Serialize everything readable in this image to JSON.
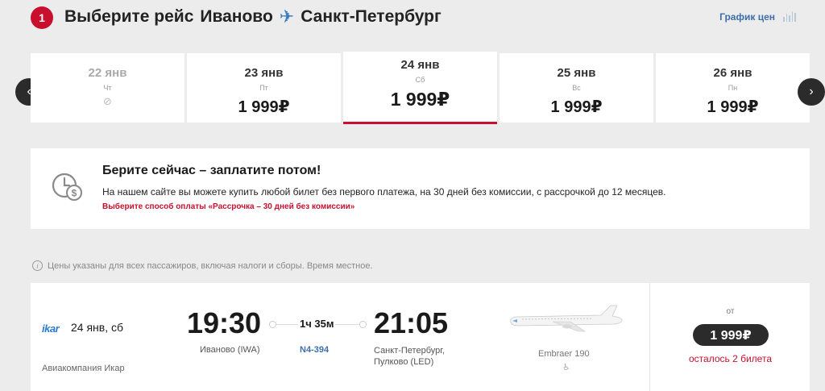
{
  "header": {
    "step": "1",
    "title_prefix": "Выберите рейс",
    "from_city": "Иваново",
    "to_city": "Санкт-Петербург",
    "price_chart_link": "График цен"
  },
  "dates": [
    {
      "date": "22 янв",
      "day": "Чт",
      "price": "",
      "available": false
    },
    {
      "date": "23 янв",
      "day": "Пт",
      "price": "1 999₽",
      "available": true
    },
    {
      "date": "24 янв",
      "day": "Сб",
      "price": "1 999₽",
      "available": true,
      "selected": true
    },
    {
      "date": "25 янв",
      "day": "Вс",
      "price": "1 999₽",
      "available": true
    },
    {
      "date": "26 янв",
      "day": "Пн",
      "price": "1 999₽",
      "available": true
    }
  ],
  "promo": {
    "title": "Берите сейчас – заплатите потом!",
    "text": "На нашем сайте вы можете купить любой билет без первого платежа, на 30 дней без комиссии, с рассрочкой до 12 месяцев.",
    "link": "Выберите способ оплаты «Рассрочка – 30 дней без комиссии»"
  },
  "price_note": "Цены указаны для всех пассажиров, включая налоги и сборы. Время местное.",
  "flight": {
    "airline_logo": "ikar",
    "date": "24 янв, сб",
    "airline_name": "Авиакомпания Икар",
    "departure_time": "19:30",
    "departure_airport": "Иваново (IWA)",
    "duration": "1ч 35м",
    "flight_number": "N4-394",
    "arrival_time": "21:05",
    "arrival_city": "Санкт-Петербург,",
    "arrival_airport": "Пулково (LED)",
    "aircraft": "Embraer 190",
    "from_label": "от",
    "price": "1 999₽",
    "seats_left": "осталось 2 билета"
  },
  "colors": {
    "accent": "#c8102e",
    "link": "#3d6fa8",
    "background": "#ececec",
    "dark": "#2b2b2b"
  }
}
